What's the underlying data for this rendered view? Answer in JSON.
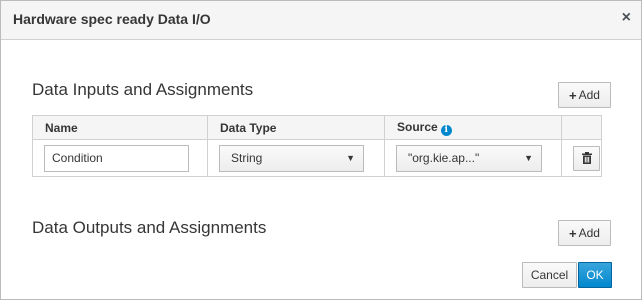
{
  "dialog": {
    "title": "Hardware spec ready Data I/O",
    "close_label": "×"
  },
  "inputs": {
    "title": "Data Inputs and Assignments",
    "add_label": "Add",
    "columns": {
      "name": "Name",
      "data_type": "Data Type",
      "source": "Source"
    },
    "rows": [
      {
        "name": "Condition",
        "data_type": "String",
        "source": "\"org.kie.ap...\""
      }
    ]
  },
  "outputs": {
    "title": "Data Outputs and Assignments",
    "add_label": "Add"
  },
  "footer": {
    "cancel_label": "Cancel",
    "ok_label": "OK"
  },
  "colors": {
    "primary": "#0088ce",
    "header_bg": "#f5f5f5",
    "border": "#d1d1d1"
  },
  "icons": [
    "close-icon",
    "plus-icon",
    "info-icon",
    "caret-down-icon",
    "trash-icon"
  ]
}
